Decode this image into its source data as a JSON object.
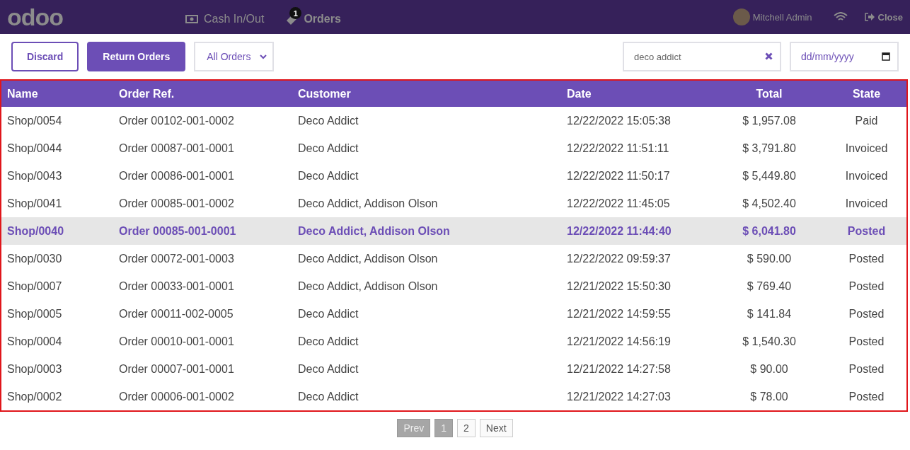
{
  "topbar": {
    "logo": "odoo",
    "nav": [
      {
        "label": "Cash In/Out",
        "selected": false
      },
      {
        "label": "Orders",
        "selected": true,
        "badge": "1"
      }
    ],
    "user": "Mitchell Admin",
    "close": "Close"
  },
  "toolbar": {
    "discard": "Discard",
    "return": "Return Orders",
    "filter": "All Orders",
    "search": {
      "value": "deco addict"
    },
    "date": {
      "placeholder": "dd/mm/yyyy"
    }
  },
  "table": {
    "columns": [
      "Name",
      "Order Ref.",
      "Customer",
      "Date",
      "Total",
      "State"
    ],
    "rows": [
      {
        "cells": [
          "Shop/0054",
          "Order 00102-001-0002",
          "Deco Addict",
          "12/22/2022 15:05:38",
          "$ 1,957.08",
          "Paid"
        ],
        "selected": false
      },
      {
        "cells": [
          "Shop/0044",
          "Order 00087-001-0001",
          "Deco Addict",
          "12/22/2022 11:51:11",
          "$ 3,791.80",
          "Invoiced"
        ],
        "selected": false
      },
      {
        "cells": [
          "Shop/0043",
          "Order 00086-001-0001",
          "Deco Addict",
          "12/22/2022 11:50:17",
          "$ 5,449.80",
          "Invoiced"
        ],
        "selected": false
      },
      {
        "cells": [
          "Shop/0041",
          "Order 00085-001-0002",
          "Deco Addict, Addison Olson",
          "12/22/2022 11:45:05",
          "$ 4,502.40",
          "Invoiced"
        ],
        "selected": false
      },
      {
        "cells": [
          "Shop/0040",
          "Order 00085-001-0001",
          "Deco Addict, Addison Olson",
          "12/22/2022 11:44:40",
          "$ 6,041.80",
          "Posted"
        ],
        "selected": true
      },
      {
        "cells": [
          "Shop/0030",
          "Order 00072-001-0003",
          "Deco Addict, Addison Olson",
          "12/22/2022 09:59:37",
          "$ 590.00",
          "Posted"
        ],
        "selected": false
      },
      {
        "cells": [
          "Shop/0007",
          "Order 00033-001-0001",
          "Deco Addict, Addison Olson",
          "12/21/2022 15:50:30",
          "$ 769.40",
          "Posted"
        ],
        "selected": false
      },
      {
        "cells": [
          "Shop/0005",
          "Order 00011-002-0005",
          "Deco Addict",
          "12/21/2022 14:59:55",
          "$ 141.84",
          "Posted"
        ],
        "selected": false
      },
      {
        "cells": [
          "Shop/0004",
          "Order 00010-001-0001",
          "Deco Addict",
          "12/21/2022 14:56:19",
          "$ 1,540.30",
          "Posted"
        ],
        "selected": false
      },
      {
        "cells": [
          "Shop/0003",
          "Order 00007-001-0001",
          "Deco Addict",
          "12/21/2022 14:27:58",
          "$ 90.00",
          "Posted"
        ],
        "selected": false
      },
      {
        "cells": [
          "Shop/0002",
          "Order 00006-001-0002",
          "Deco Addict",
          "12/21/2022 14:27:03",
          "$ 78.00",
          "Posted"
        ],
        "selected": false
      }
    ]
  },
  "pagination": {
    "prev": {
      "label": "Prev",
      "disabled": true
    },
    "pages": [
      {
        "label": "1",
        "selected": true
      },
      {
        "label": "2",
        "selected": false
      }
    ],
    "next": {
      "label": "Next",
      "disabled": false
    }
  }
}
